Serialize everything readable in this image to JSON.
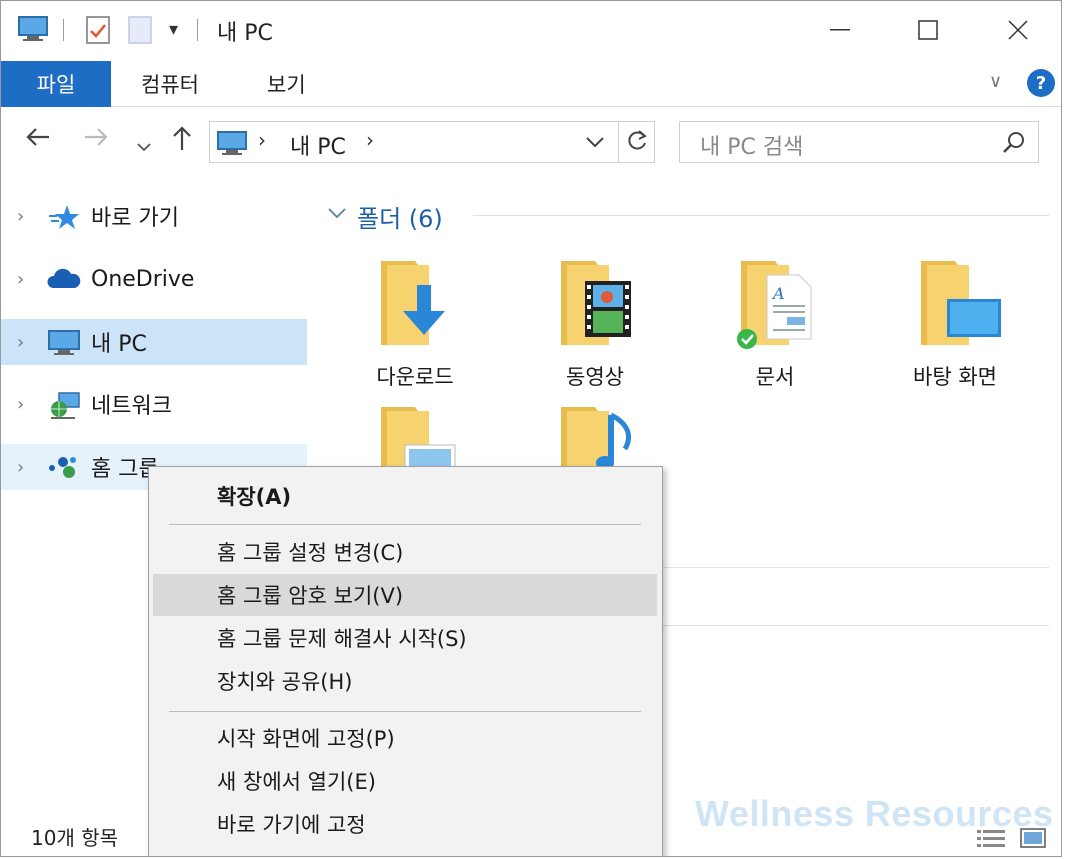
{
  "window": {
    "title": "내 PC"
  },
  "ribbon": {
    "file_tab": "파일",
    "tabs": [
      "컴퓨터",
      "보기"
    ],
    "help": "?"
  },
  "nav": {
    "address_text": "내 PC",
    "search_placeholder": "내 PC 검색"
  },
  "sidebar": {
    "items": [
      {
        "label": "바로 가기",
        "icon": "star-icon"
      },
      {
        "label": "OneDrive",
        "icon": "cloud-icon"
      },
      {
        "label": "내 PC",
        "icon": "computer-icon",
        "selected": true
      },
      {
        "label": "네트워크",
        "icon": "network-icon"
      },
      {
        "label": "홈 그룹",
        "icon": "homegroup-icon",
        "hover": true
      }
    ]
  },
  "main": {
    "group_title": "폴더 (6)",
    "folders": [
      {
        "label": "다운로드",
        "icon": "downloads-folder-icon"
      },
      {
        "label": "동영상",
        "icon": "videos-folder-icon"
      },
      {
        "label": "문서",
        "icon": "documents-folder-icon"
      },
      {
        "label": "바탕 화면",
        "icon": "desktop-folder-icon"
      },
      {
        "label": "",
        "icon": "pictures-folder-icon"
      },
      {
        "label": "",
        "icon": "music-folder-icon"
      }
    ]
  },
  "context_menu": {
    "items": [
      {
        "label": "확장(A)",
        "bold": true
      },
      {
        "label": "홈 그룹 설정 변경(C)"
      },
      {
        "label": "홈 그룹 암호 보기(V)",
        "highlighted": true
      },
      {
        "label": "홈 그룹 문제 해결사 시작(S)"
      },
      {
        "label": "장치와 공유(H)"
      },
      {
        "label": "시작 화면에 고정(P)"
      },
      {
        "label": "새 창에서 열기(E)"
      },
      {
        "label": "바로 가기에 고정"
      }
    ]
  },
  "status": {
    "item_count": "10개 항목"
  },
  "watermark": "Wellness Resources",
  "colors": {
    "accent": "#1e6dc4",
    "selection": "#cce4f7",
    "folder": "#f6d36f",
    "group_title": "#1e5fa8"
  }
}
